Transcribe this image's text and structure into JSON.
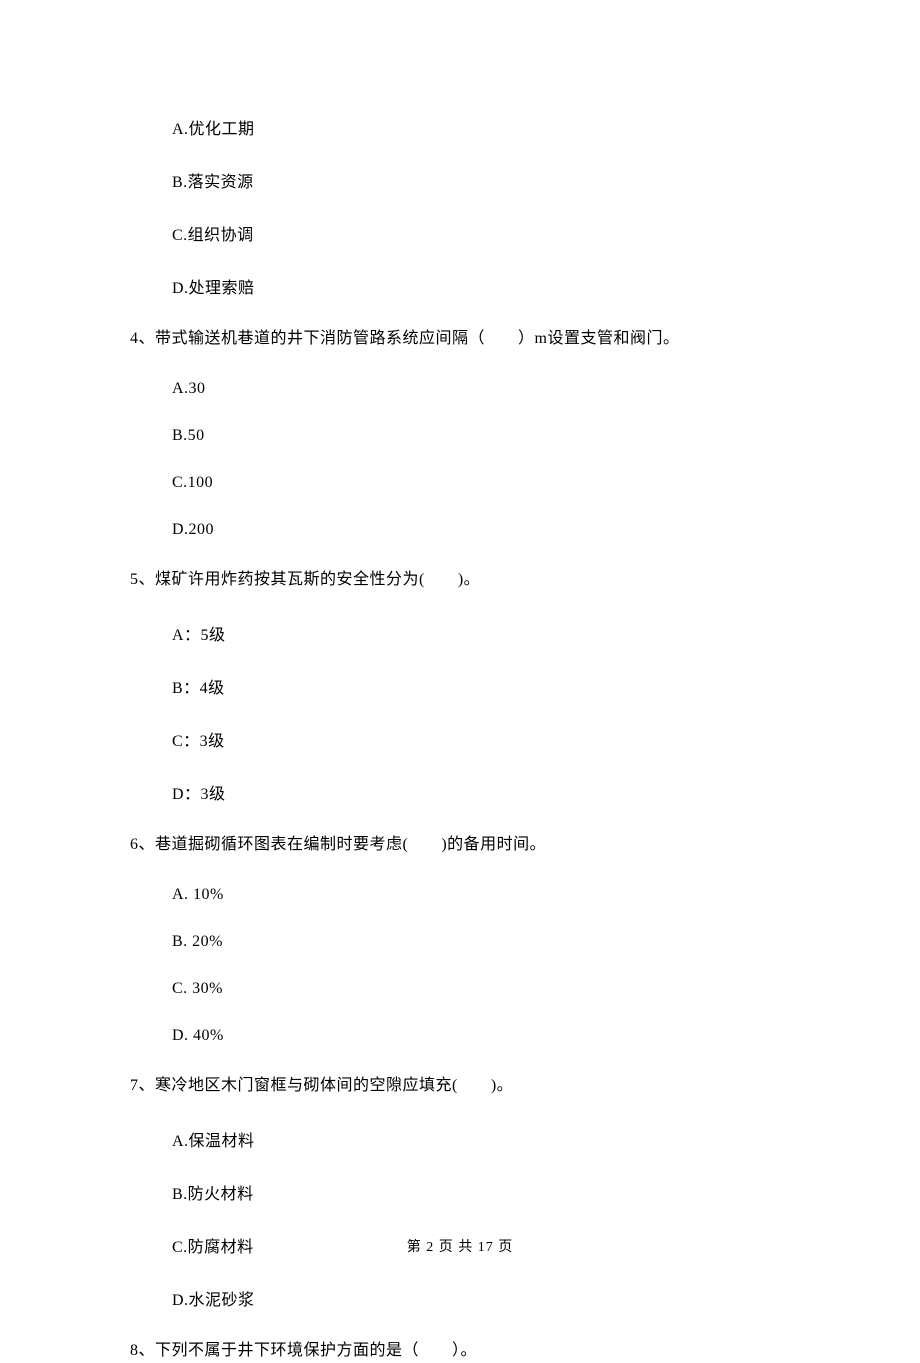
{
  "questions": [
    {
      "number": "",
      "stem": "",
      "options": [
        "A.优化工期",
        "B.落实资源",
        "C.组织协调",
        "D.处理索赔"
      ]
    },
    {
      "number": "4、",
      "stem": "带式输送机巷道的井下消防管路系统应间隔（　　）m设置支管和阀门。",
      "options": [
        "A.30",
        "B.50",
        "C.100",
        "D.200"
      ]
    },
    {
      "number": "5、",
      "stem": "煤矿许用炸药按其瓦斯的安全性分为(　　)。",
      "options": [
        "A：5级",
        "B：4级",
        "C：3级",
        "D：3级"
      ]
    },
    {
      "number": "6、",
      "stem": "巷道掘砌循环图表在编制时要考虑(　　)的备用时间。",
      "options": [
        "A. 10%",
        "B. 20%",
        "C. 30%",
        "D. 40%"
      ]
    },
    {
      "number": "7、",
      "stem": "寒冷地区木门窗框与砌体间的空隙应填充(　　)。",
      "options": [
        "A.保温材料",
        "B.防火材料",
        "C.防腐材料",
        "D.水泥砂浆"
      ]
    },
    {
      "number": "8、",
      "stem": "下列不属于井下环境保护方面的是（　　）。",
      "options": []
    }
  ],
  "footer": "第 2 页 共 17 页"
}
